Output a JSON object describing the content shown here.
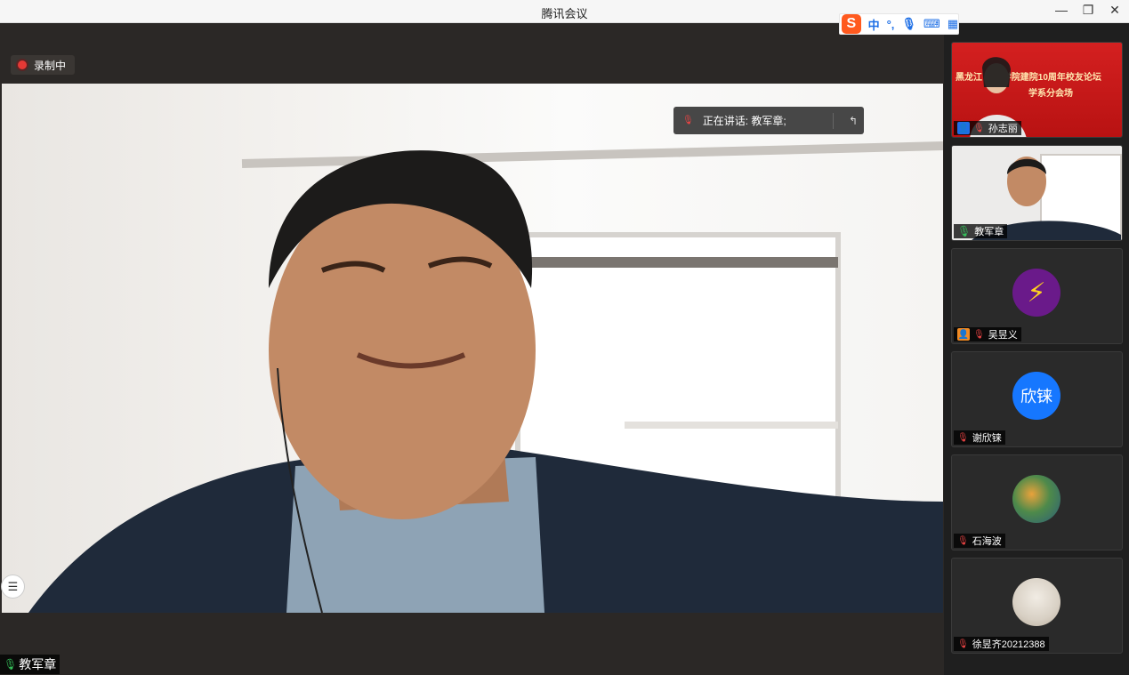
{
  "window": {
    "title": "腾讯会议",
    "minimize": "—",
    "restore": "❐",
    "close": "✕"
  },
  "ime": {
    "logo": "S",
    "mode": "中",
    "punct": "°,",
    "mic": "🎙",
    "keyboard": "⌨",
    "grid": "▦"
  },
  "recording": {
    "label": "录制中"
  },
  "speaking": {
    "text": "正在讲话: 教军章;"
  },
  "main_speaker": {
    "name": "教军章"
  },
  "participants": [
    {
      "name": "孙志丽",
      "banner_title": "黑龙江        管理学院建院10周年校友论坛",
      "banner_sub": "学系分会场",
      "badge_color": "#1e6fe6",
      "muted": true
    },
    {
      "name": "教军章",
      "muted": false
    },
    {
      "name": "吴昱义",
      "avatar_icon": "lightning-icon",
      "avatar_color": "#6a1a8a",
      "badge_color": "#f08a24",
      "muted": true
    },
    {
      "name": "谢欣铼",
      "avatar_text": "欣铼",
      "avatar_color": "#1677ff",
      "muted": true
    },
    {
      "name": "石海波",
      "avatar_color": "#4e8a4a",
      "muted": true
    },
    {
      "name": "徐昱齐20212388",
      "avatar_color": "#d8d0c4",
      "muted": true
    }
  ]
}
